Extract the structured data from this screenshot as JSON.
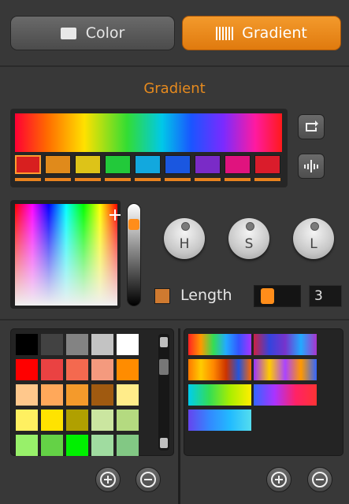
{
  "tabs": [
    {
      "label": "Color",
      "icon": "color-swatch-icon",
      "active": false
    },
    {
      "label": "Gradient",
      "icon": "gradient-bars-icon",
      "active": true
    }
  ],
  "section_title": "Gradient",
  "gradient_stops": [
    "#d81f1f",
    "#e08a1b",
    "#ddc318",
    "#22c93a",
    "#12a8de",
    "#1a57e0",
    "#7a2bc7",
    "#e0137e",
    "#da1c2b"
  ],
  "toolbar": {
    "reverse_icon": "reverse-icon",
    "distribute_icon": "distribute-stops-icon"
  },
  "knobs": [
    {
      "label": "H"
    },
    {
      "label": "S"
    },
    {
      "label": "L"
    }
  ],
  "length": {
    "label": "Length",
    "checked": true,
    "value": "3"
  },
  "palette": [
    [
      "#000000",
      "#424242",
      "#838383",
      "#c3c3c3",
      "#ffffff"
    ],
    [
      "#ff0000",
      "#ea4242",
      "#f4694f",
      "#f49a7e",
      "#ff8c00"
    ],
    [
      "#ffc88c",
      "#ffa85a",
      "#f49a2b",
      "#a05a10",
      "#ffec8a"
    ],
    [
      "#fff060",
      "#ffe300",
      "#b0a000",
      "#cbe6a0",
      "#b4da80"
    ],
    [
      "#98f06a",
      "#64d246",
      "#00f000",
      "#a0dca0",
      "#82c884"
    ]
  ],
  "gradient_presets": [
    {
      "name": "rainbow-1",
      "stops": [
        "#ff2222",
        "#ff9900",
        "#33dd55",
        "#22aaff",
        "#3355ff",
        "#aa33ff"
      ]
    },
    {
      "name": "rainbow-2",
      "stops": [
        "#cc2244",
        "#3344dd",
        "#7733cc",
        "#22aaff",
        "#aa33cc"
      ]
    },
    {
      "name": "rainbow-3",
      "stops": [
        "#ff7700",
        "#ffcc00",
        "#ff8800",
        "#cc3300",
        "#2255dd",
        "#ff6600"
      ]
    },
    {
      "name": "rainbow-4",
      "stops": [
        "#9933ff",
        "#ffcc00",
        "#aa44ff",
        "#ff9900",
        "#3366ff"
      ]
    },
    {
      "name": "rainbow-5",
      "stops": [
        "#00ccee",
        "#33dd55",
        "#aaee00",
        "#ffee00"
      ]
    },
    {
      "name": "rainbow-6",
      "stops": [
        "#3366ff",
        "#aa33ff",
        "#ff2266",
        "#ff3333"
      ]
    },
    {
      "name": "rainbow-7",
      "stops": [
        "#6644ee",
        "#3388ff",
        "#22bbff",
        "#55ddee"
      ]
    }
  ],
  "colors": {
    "accent": "#e8821e",
    "bg": "#383838",
    "panel": "#242424"
  }
}
